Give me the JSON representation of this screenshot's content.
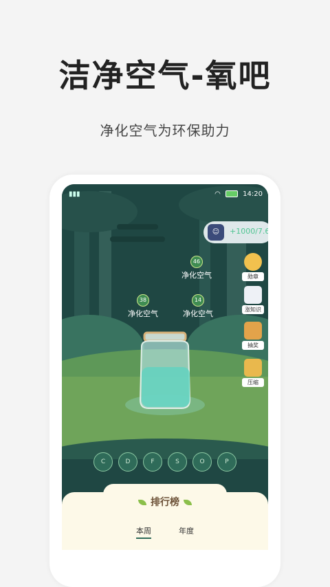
{
  "headline": "洁净空气-氧吧",
  "subline": "净化空气为环保助力",
  "status_bar": {
    "time": "14:20"
  },
  "user": {
    "value": "+1000/7.6"
  },
  "side_buttons": [
    {
      "label": "勋章",
      "icon": "medal-icon",
      "color": "#f2c14e"
    },
    {
      "label": "涨知识",
      "icon": "book-icon",
      "color": "#eef1f6"
    },
    {
      "label": "抽奖",
      "icon": "gift-box-icon",
      "color": "#e3a34a"
    },
    {
      "label": "压缩",
      "icon": "box-icon",
      "color": "#e9b84d"
    }
  ],
  "bubbles": [
    {
      "num": "46",
      "label": "净化空气"
    },
    {
      "num": "38",
      "label": "净化空气"
    },
    {
      "num": "14",
      "label": "净化空气"
    }
  ],
  "badges": [
    "C",
    "D",
    "F",
    "S",
    "O",
    "P"
  ],
  "ranking": {
    "title": "排行榜",
    "tabs": [
      "本周",
      "年度"
    ]
  },
  "colors": {
    "forest": "#1f4743",
    "grass": "#6fa45a",
    "accent": "#4fc492"
  }
}
